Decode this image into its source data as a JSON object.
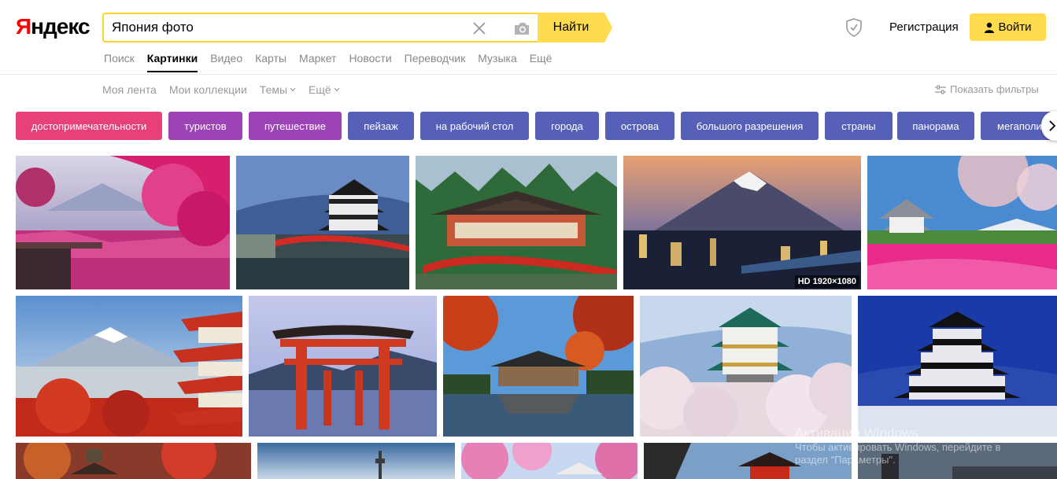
{
  "logo": {
    "first": "Я",
    "rest": "ндекс"
  },
  "search": {
    "value": "Япония фото",
    "button_label": "Найти"
  },
  "header": {
    "register_label": "Регистрация",
    "login_label": "Войти"
  },
  "services": [
    "Поиск",
    "Картинки",
    "Видео",
    "Карты",
    "Маркет",
    "Новости",
    "Переводчик",
    "Музыка",
    "Ещё"
  ],
  "services_active": "Картинки",
  "subnav": {
    "feed": "Моя лента",
    "collections": "Мои коллекции",
    "themes": "Темы",
    "more": "Ещё",
    "show_filters": "Показать фильтры"
  },
  "tags": [
    {
      "label": "достопримечательности",
      "color": "#e8407a"
    },
    {
      "label": "туристов",
      "color": "#9c43b5"
    },
    {
      "label": "путешествие",
      "color": "#9c43b5"
    },
    {
      "label": "пейзаж",
      "color": "#5660b8"
    },
    {
      "label": "на рабочий стол",
      "color": "#5660b8"
    },
    {
      "label": "города",
      "color": "#5660b8"
    },
    {
      "label": "острова",
      "color": "#5660b8"
    },
    {
      "label": "большого разрешения",
      "color": "#5660b8"
    },
    {
      "label": "страны",
      "color": "#5660b8"
    },
    {
      "label": "панорама",
      "color": "#5660b8"
    },
    {
      "label": "мегаполис",
      "color": "#5660b8"
    }
  ],
  "images": [
    {
      "alt": "sakura-lake"
    },
    {
      "alt": "castle-red-bridge"
    },
    {
      "alt": "temple-forest"
    },
    {
      "alt": "fuji-city-night",
      "badge": "HD 1920×1080"
    },
    {
      "alt": "castle-pink-field"
    },
    {
      "alt": "fuji-pagoda"
    },
    {
      "alt": "torii-gate"
    },
    {
      "alt": "autumn-temple-lake"
    },
    {
      "alt": "osaka-castle-blossom"
    },
    {
      "alt": "matsumoto-castle-snow"
    },
    {
      "alt": "autumn-pagoda"
    },
    {
      "alt": "tower-sky"
    },
    {
      "alt": "pink-blossom-castle"
    },
    {
      "alt": "red-temple"
    },
    {
      "alt": "dark-tower"
    }
  ],
  "watermark": {
    "line1": "Активация Windows",
    "line2": "Чтобы активировать Windows, перейдите в",
    "line3": "раздел \"Параметры\"."
  },
  "colors": {
    "accent": "#ffdb4d",
    "search_border": "#fed42b",
    "logo_red": "#ff0000"
  }
}
